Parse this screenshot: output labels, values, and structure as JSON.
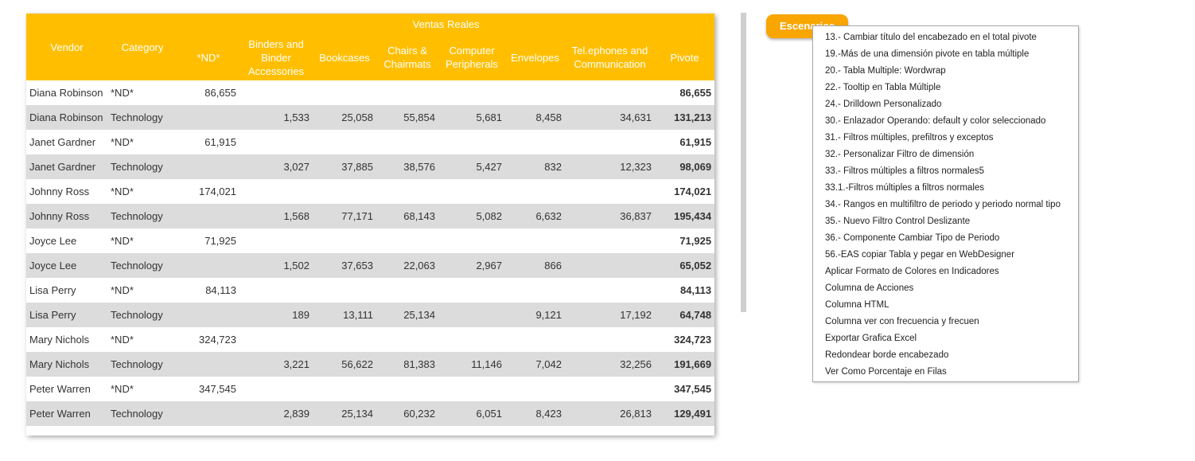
{
  "table": {
    "group_header": "Ventas Reales",
    "columns": [
      "Vendor",
      "Category",
      "*ND*",
      "Binders and Binder Accessories",
      "Bookcases",
      "Chairs & Chairmats",
      "Computer Peripherals",
      "Envelopes",
      "Tel.ephones and Communication",
      "Pivote"
    ],
    "rows": [
      [
        "Diana Robinson",
        "*ND*",
        "86,655",
        "",
        "",
        "",
        "",
        "",
        "",
        "86,655"
      ],
      [
        "Diana Robinson",
        "Technology",
        "",
        "1,533",
        "25,058",
        "55,854",
        "5,681",
        "8,458",
        "34,631",
        "131,213"
      ],
      [
        "Janet Gardner",
        "*ND*",
        "61,915",
        "",
        "",
        "",
        "",
        "",
        "",
        "61,915"
      ],
      [
        "Janet Gardner",
        "Technology",
        "",
        "3,027",
        "37,885",
        "38,576",
        "5,427",
        "832",
        "12,323",
        "98,069"
      ],
      [
        "Johnny Ross",
        "*ND*",
        "174,021",
        "",
        "",
        "",
        "",
        "",
        "",
        "174,021"
      ],
      [
        "Johnny Ross",
        "Technology",
        "",
        "1,568",
        "77,171",
        "68,143",
        "5,082",
        "6,632",
        "36,837",
        "195,434"
      ],
      [
        "Joyce Lee",
        "*ND*",
        "71,925",
        "",
        "",
        "",
        "",
        "",
        "",
        "71,925"
      ],
      [
        "Joyce Lee",
        "Technology",
        "",
        "1,502",
        "37,653",
        "22,063",
        "2,967",
        "866",
        "",
        "65,052"
      ],
      [
        "Lisa Perry",
        "*ND*",
        "84,113",
        "",
        "",
        "",
        "",
        "",
        "",
        "84,113"
      ],
      [
        "Lisa Perry",
        "Technology",
        "",
        "189",
        "13,111",
        "25,134",
        "",
        "9,121",
        "17,192",
        "64,748"
      ],
      [
        "Mary Nichols",
        "*ND*",
        "324,723",
        "",
        "",
        "",
        "",
        "",
        "",
        "324,723"
      ],
      [
        "Mary Nichols",
        "Technology",
        "",
        "3,221",
        "56,622",
        "81,383",
        "11,146",
        "7,042",
        "32,256",
        "191,669"
      ],
      [
        "Peter Warren",
        "*ND*",
        "347,545",
        "",
        "",
        "",
        "",
        "",
        "",
        "347,545"
      ],
      [
        "Peter Warren",
        "Technology",
        "",
        "2,839",
        "25,134",
        "60,232",
        "6,051",
        "8,423",
        "26,813",
        "129,491"
      ]
    ]
  },
  "scenarios_button": {
    "label": "Escenarios"
  },
  "scenarios_menu": {
    "items": [
      "13.- Cambiar título del encabezado en el total pivote",
      "19.-Más de una dimensión pivote en tabla múltiple",
      "20.- Tabla Multiple: Wordwrap",
      "22.- Tooltip en Tabla Múltiple",
      "24.- Drilldown Personalizado",
      "30.- Enlazador Operando: default y color seleccionado",
      "31.- Filtros múltiples, prefiltros y exceptos",
      "32.- Personalizar Filtro de dimensión",
      "33.- Filtros múltiples a filtros normales5",
      "33.1.-Filtros múltiples a filtros normales",
      "34.- Rangos en multifiltro de periodo y periodo normal tipo",
      "35.- Nuevo Filtro Control Deslizante",
      "36.- Componente Cambiar Tipo de Periodo",
      "56.-EAS copiar Tabla y pegar en WebDesigner",
      "Aplicar Formato de Colores en Indicadores",
      "Columna de Acciones",
      "Columna HTML",
      "Columna ver con frecuencia y frecuen",
      "Exportar Grafica Excel",
      "Redondear borde encabezado",
      "Ver Como Porcentaje en Filas"
    ]
  },
  "colors": {
    "header_bg": "#ffbf00",
    "button_bg": "#f9a602",
    "stripe": "#dcdcdc"
  }
}
